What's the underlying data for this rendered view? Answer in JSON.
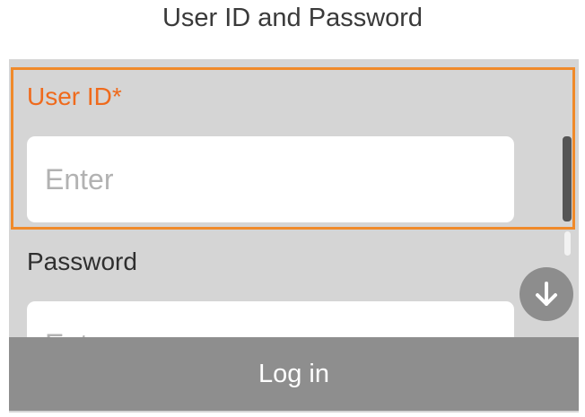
{
  "screen": {
    "title": "User ID and Password"
  },
  "form": {
    "user_id": {
      "label": "User ID*",
      "placeholder": "Enter",
      "value": ""
    },
    "password": {
      "label": "Password",
      "placeholder": "Enter",
      "value": ""
    }
  },
  "actions": {
    "login_label": "Log in",
    "scroll_down_icon": "arrow-down-circle"
  },
  "theme": {
    "focus_color": "#f08a2a",
    "required_label_color": "#ef6a1c",
    "panel_color": "#d5d5d5",
    "button_color": "#8e8e8e"
  }
}
